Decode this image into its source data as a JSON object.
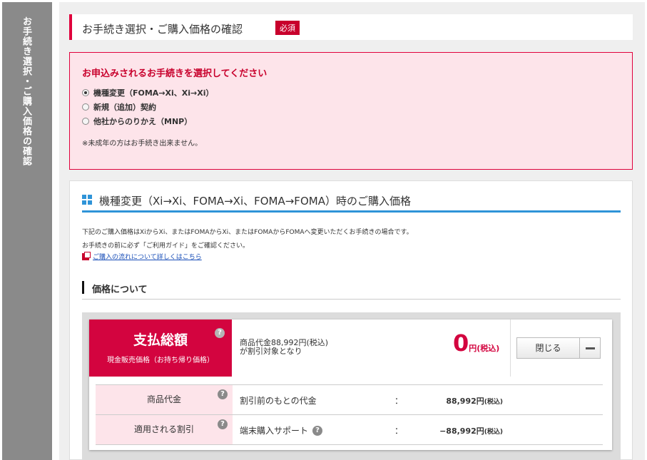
{
  "sidebar": {
    "text": "お手続き選択・ご購入価格の確認"
  },
  "section": {
    "title": "お手続き選択・ご購入価格の確認",
    "required_badge": "必須"
  },
  "procedure": {
    "question": "お申込みされるお手続きを選択してください",
    "options": [
      {
        "label": "機種変更（FOMA→Xi、Xi→Xi）",
        "checked": true
      },
      {
        "label": "新規（追加）契約",
        "checked": false
      },
      {
        "label": "他社からのりかえ（MNP）",
        "checked": false
      }
    ],
    "note": "※未成年の方はお手続き出来ません。"
  },
  "price_panel": {
    "title": "機種変更（Xi→Xi、FOMA→Xi、FOMA→FOMA）時のご購入価格",
    "desc1": "下記のご購入価格はXiからXi、またはFOMAからXi、またはFOMAからFOMAへ変更いただくお手続きの場合です。",
    "desc2": "お手続きの前に必ず「ご利用ガイド」をご確認ください。",
    "guide_link": "ご購入の流れについて詳しくはこちら",
    "subheading": "価格について",
    "total": {
      "label": "支払総額",
      "sublabel": "現金販売価格（お持ち帰り価格）",
      "desc_line1": "商品代金88,992円(税込)",
      "desc_line2": "が割引対象となり",
      "amount": "0",
      "unit": "円(税込)",
      "close_label": "閉じる"
    },
    "rows": [
      {
        "head": "商品代金",
        "label": "割引前のもとの代金",
        "colon": "：",
        "amount": "88,992円",
        "tax": "(税込)"
      },
      {
        "head": "適用される割引",
        "label": "端末購入サポート",
        "colon": "：",
        "amount": "−88,992円",
        "tax": "(税込)"
      }
    ],
    "help_glyph": "?"
  },
  "colors": {
    "accent": "#d3043f",
    "blue": "#2f94d8",
    "pink_bg": "#fde4ea"
  }
}
